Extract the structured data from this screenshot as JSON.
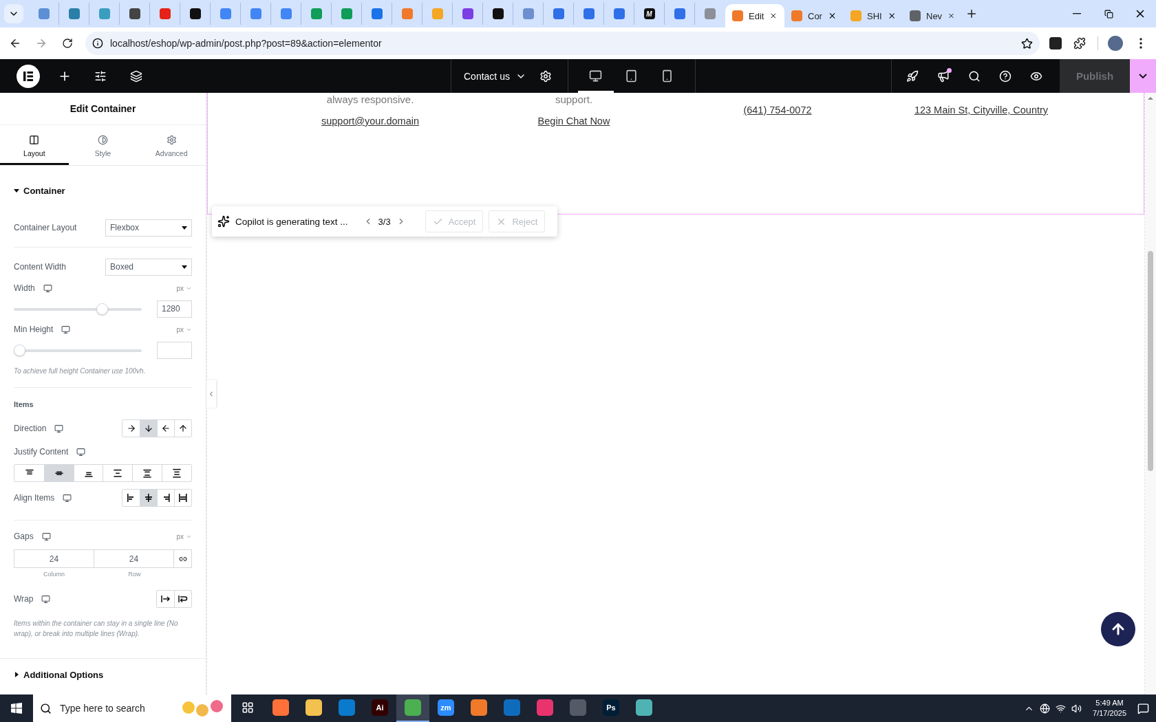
{
  "browser": {
    "pinned_tabs": [
      {
        "color": "#5b8fd6"
      },
      {
        "color": "#2a7fa8"
      },
      {
        "color": "#3a9fbf"
      },
      {
        "color": "#444444"
      },
      {
        "color": "#e62117"
      },
      {
        "color": "#111111"
      },
      {
        "color": "#4285f4"
      },
      {
        "color": "#4285f4"
      },
      {
        "color": "#4285f4"
      },
      {
        "color": "#0f9d58"
      },
      {
        "color": "#0f9d58"
      },
      {
        "color": "#1a73e8"
      },
      {
        "color": "#f0792a"
      },
      {
        "color": "#f5a623"
      },
      {
        "color": "#7b3fe4"
      },
      {
        "color": "#111111"
      },
      {
        "color": "#6d8fcf"
      },
      {
        "color": "#2f6fe8"
      },
      {
        "color": "#2f6fe8"
      },
      {
        "color": "#2f6fe8"
      },
      {
        "color": "#111111",
        "label": "M"
      },
      {
        "color": "#2f6fe8"
      },
      {
        "color": "#8a8f98"
      }
    ],
    "tabs": [
      {
        "title": "Edit",
        "selected": true,
        "color": "#f0792a"
      },
      {
        "title": "Cor",
        "selected": false,
        "color": "#f0792a"
      },
      {
        "title": "SHI",
        "selected": false,
        "color": "#f5a623"
      },
      {
        "title": "Nev",
        "selected": false,
        "color": "#5f6368"
      }
    ],
    "url": "localhost/eshop/wp-admin/post.php?post=89&action=elementor"
  },
  "editor_bar": {
    "page": "Contact us",
    "devices": [
      {
        "selected": true
      },
      {
        "selected": false
      },
      {
        "selected": false
      }
    ],
    "notification": true,
    "publish": {
      "label": "Publish",
      "disabled": true
    }
  },
  "panel": {
    "title": "Edit Container",
    "tabs": [
      {
        "label": "Layout",
        "selected": true
      },
      {
        "label": "Style",
        "selected": false
      },
      {
        "label": "Advanced",
        "selected": false
      }
    ],
    "sections": [
      {
        "title": "Container",
        "expanded": true,
        "controls": [
          {
            "kind": "select",
            "label": "Container Layout",
            "value": "Flexbox"
          },
          {
            "kind": "divider"
          },
          {
            "kind": "select",
            "label": "Content Width",
            "value": "Boxed"
          },
          {
            "kind": "slider",
            "label": "Width",
            "responsive": true,
            "unit": "px",
            "level": 0.71,
            "value": "1280"
          },
          {
            "kind": "slider",
            "label": "Min Height",
            "responsive": true,
            "unit": "px",
            "level": 0
          },
          {
            "kind": "note",
            "text": "To achieve full height Container use 100vh."
          },
          {
            "kind": "divider"
          },
          {
            "kind": "heading",
            "text": "Items"
          },
          {
            "kind": "choices",
            "label": "Direction",
            "responsive": true,
            "options": [
              {
                "selected": false
              },
              {
                "selected": true
              },
              {
                "selected": false
              },
              {
                "selected": false
              }
            ]
          },
          {
            "kind": "choices",
            "label": "Justify Content",
            "responsive": true,
            "wide": true,
            "options": [
              {
                "selected": false
              },
              {
                "selected": true
              },
              {
                "selected": false
              },
              {
                "selected": false
              },
              {
                "selected": false
              },
              {
                "selected": false
              }
            ]
          },
          {
            "kind": "choices",
            "label": "Align Items",
            "responsive": true,
            "options": [
              {
                "selected": false
              },
              {
                "selected": true
              },
              {
                "selected": false
              },
              {
                "selected": false
              }
            ]
          },
          {
            "kind": "divider"
          },
          {
            "kind": "gaps",
            "label": "Gaps",
            "responsive": true,
            "unit": "px",
            "fields": [
              {
                "value": "24",
                "caption": "Column"
              },
              {
                "value": "24",
                "caption": "Row"
              }
            ]
          },
          {
            "kind": "choices",
            "label": "Wrap",
            "responsive": true,
            "options": [
              {
                "selected": false
              },
              {
                "selected": false
              }
            ]
          },
          {
            "kind": "note",
            "text": "Items within the container can stay in a single line (No wrap), or break into multiple lines (Wrap)."
          }
        ]
      },
      {
        "title": "Additional Options",
        "expanded": false
      }
    ]
  },
  "canvas": {
    "columns": [
      {
        "text": "always responsive.",
        "link": "support@your.domain"
      },
      {
        "text": "support.",
        "link": "Begin Chat Now"
      },
      {
        "link": "(641) 754-0072"
      },
      {
        "link": "123 Main St, Cityville, Country"
      }
    ]
  },
  "copilot": {
    "status": "Copilot is generating text ...",
    "counter": "3/3",
    "actions": [
      {
        "kind": "accept",
        "label": "Accept",
        "disabled": true
      },
      {
        "kind": "reject",
        "label": "Reject",
        "disabled": true
      }
    ]
  },
  "taskbar": {
    "search_placeholder": "Type here to search",
    "apps": [
      {
        "color": "#ff7139",
        "selected": false
      },
      {
        "color": "#f2c14e",
        "selected": false
      },
      {
        "color": "#0a7acc",
        "selected": false
      },
      {
        "color": "#330000",
        "label": "Ai",
        "selected": false
      },
      {
        "color": "#4caf50",
        "selected": true
      },
      {
        "color": "#2d8cff",
        "label": "zm",
        "selected": false
      },
      {
        "color": "#f0792a",
        "selected": false
      },
      {
        "color": "#0f6cbd",
        "selected": false
      },
      {
        "color": "#e8336e",
        "selected": false
      },
      {
        "color": "#555b66",
        "selected": false
      },
      {
        "color": "#001e36",
        "label": "Ps",
        "selected": false
      },
      {
        "color": "#4fb3b3",
        "selected": false
      }
    ],
    "time": "5:49 AM",
    "date": "7/17/2025"
  }
}
